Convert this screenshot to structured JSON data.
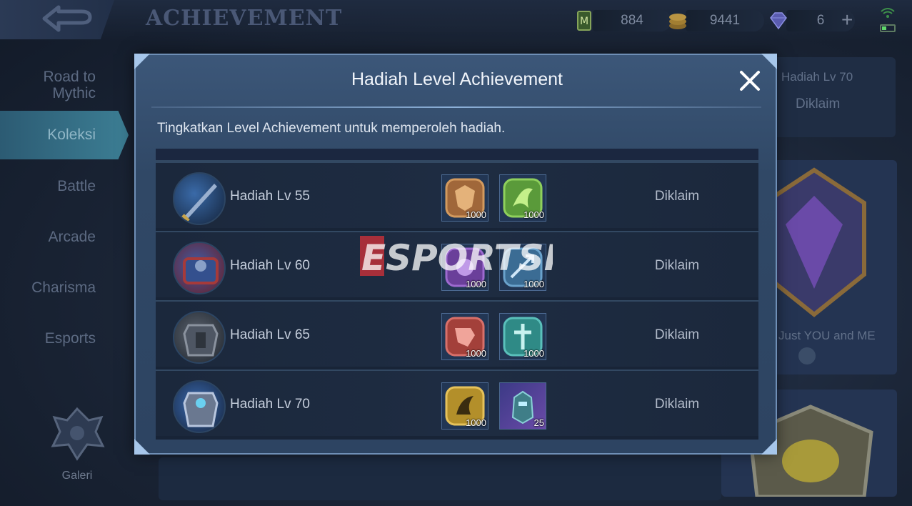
{
  "header": {
    "title": "ACHIEVEMENT",
    "currencies": [
      {
        "icon": "magic-dust-icon",
        "value": "884"
      },
      {
        "icon": "battle-points-icon",
        "value": "9441"
      },
      {
        "icon": "diamond-icon",
        "value": "6"
      }
    ],
    "add_label": "+"
  },
  "sidebar": {
    "items": [
      {
        "label": "Road to Mythic"
      },
      {
        "label": "Koleksi"
      },
      {
        "label": "Battle"
      },
      {
        "label": "Arcade"
      },
      {
        "label": "Charisma"
      },
      {
        "label": "Esports"
      }
    ],
    "gallery_label": "Galeri"
  },
  "background": {
    "panel_title": "Hadiah Lv 70",
    "panel_status": "Diklaim",
    "card_caption": "Just YOU and ME"
  },
  "modal": {
    "title": "Hadiah Level Achievement",
    "subtitle": "Tingkatkan Level Achievement untuk memperoleh hadiah.",
    "rows": [
      {
        "label": "Hadiah Lv 55",
        "status": "Diklaim",
        "rewards": [
          {
            "icon": "tank-emblem-icon",
            "qty": "1000",
            "color": "#a0673a"
          },
          {
            "icon": "assassin-emblem-icon",
            "qty": "1000",
            "color": "#5a9a3a"
          }
        ]
      },
      {
        "label": "Hadiah Lv 60",
        "status": "Diklaim",
        "rewards": [
          {
            "icon": "mage-emblem-icon",
            "qty": "1000",
            "color": "#6a3f9a"
          },
          {
            "icon": "marksman-emblem-icon",
            "qty": "1000",
            "color": "#3b6c94"
          }
        ]
      },
      {
        "label": "Hadiah Lv 65",
        "status": "Diklaim",
        "rewards": [
          {
            "icon": "fighter-emblem-icon",
            "qty": "1000",
            "color": "#a3403a"
          },
          {
            "icon": "support-emblem-icon",
            "qty": "1000",
            "color": "#2f8a86"
          }
        ]
      },
      {
        "label": "Hadiah Lv 70",
        "status": "Diklaim",
        "rewards": [
          {
            "icon": "jungle-emblem-icon",
            "qty": "1000",
            "color": "#b38f2a"
          },
          {
            "icon": "hero-fragment-icon",
            "qty": "25",
            "color": "#3c3a86"
          }
        ]
      }
    ]
  },
  "watermark": {
    "text": "ESPORTSKU"
  }
}
